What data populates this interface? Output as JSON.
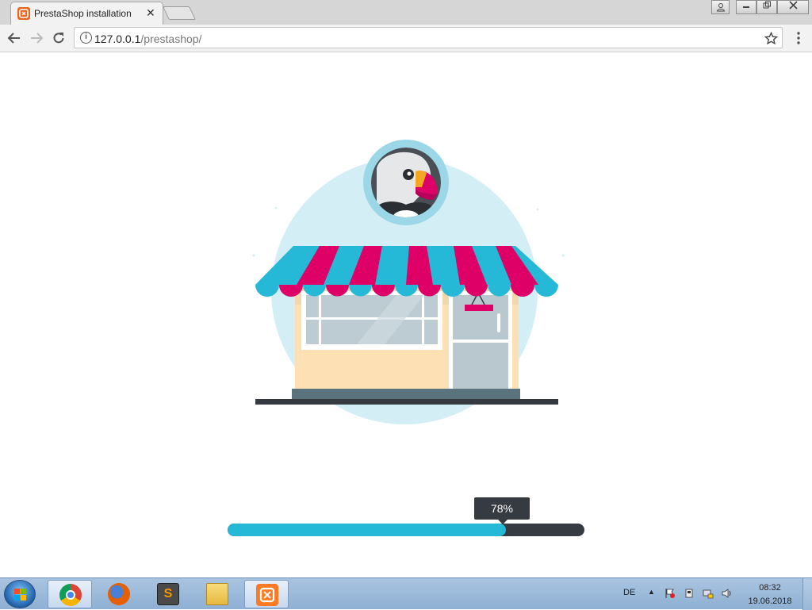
{
  "browser": {
    "tab": {
      "title": "PrestaShop installation",
      "favicon": "prestashop-logo-icon"
    },
    "tab_close": "✕",
    "address": {
      "host": "127.0.0.1",
      "path": "/prestashop/"
    },
    "colors": {
      "prestashop_orange": "#e8651e"
    }
  },
  "installer": {
    "illustration": "prestashop-storefront-with-puffin-mascot",
    "progress": {
      "label": "78%",
      "value": 0.78
    },
    "colors": {
      "accent": "#25b9d7",
      "track": "#363a41",
      "awning_pink": "#df0067",
      "circle_bg": "#d4eef5"
    }
  },
  "taskbar": {
    "apps": [
      "chrome-icon",
      "firefox-icon",
      "sublime-text-icon",
      "file-explorer-icon",
      "xampp-icon"
    ],
    "sublime_glyph": "S",
    "language": "DE",
    "tray_arrow": "▲",
    "clock": {
      "time": "08:32",
      "date": "19.06.2018"
    }
  }
}
